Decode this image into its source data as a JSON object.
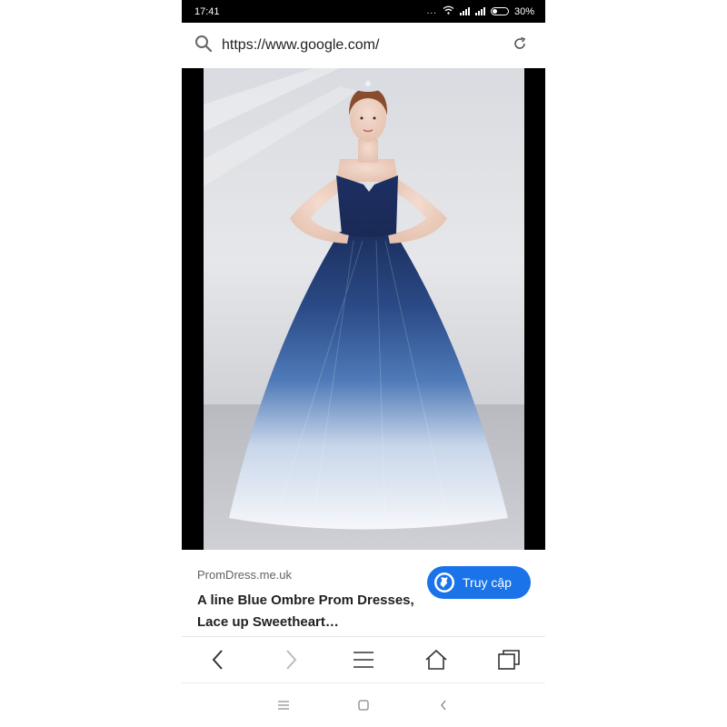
{
  "status_bar": {
    "time": "17:41",
    "dots": "...",
    "battery_percent": "30%",
    "icons": [
      "wifi-icon",
      "signal-icon",
      "signal-icon",
      "battery-icon"
    ]
  },
  "address_bar": {
    "url": "https://www.google.com/",
    "icons": [
      "search-icon",
      "reload-icon"
    ]
  },
  "result": {
    "source": "PromDress.me.uk",
    "title": "A line Blue Ombre Prom Dresses, Lace up Sweetheart…",
    "visit_label": "Truy cập"
  },
  "toolbar": {
    "icons": [
      "back-icon",
      "forward-icon",
      "menu-icon",
      "home-icon",
      "tabs-icon"
    ]
  },
  "system_nav": {
    "icons": [
      "menu-icon",
      "home-square-icon",
      "back-icon"
    ]
  },
  "colors": {
    "accent": "#1a73e8",
    "status_bar_bg": "#000000",
    "dress_navy": "#1c2f5e"
  }
}
